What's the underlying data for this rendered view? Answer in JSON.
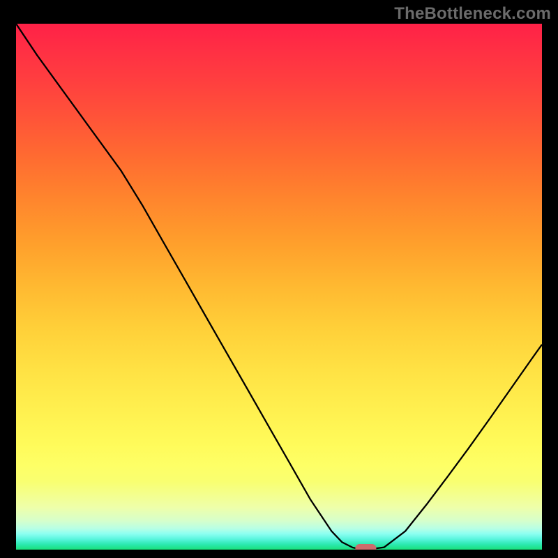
{
  "watermark": "TheBottleneck.com",
  "chart_data": {
    "type": "line",
    "title": "",
    "xlabel": "",
    "ylabel": "",
    "xlim": [
      0,
      100
    ],
    "ylim": [
      0,
      100
    ],
    "axes_visible": false,
    "grid": false,
    "series": [
      {
        "name": "bottleneck-curve",
        "x": [
          0,
          4,
          8,
          12,
          16,
          20,
          24,
          28,
          32,
          36,
          40,
          44,
          48,
          52,
          56,
          60,
          62,
          64,
          65.2,
          67.8,
          70,
          74,
          78,
          82,
          86,
          90,
          94,
          98,
          100
        ],
        "y": [
          100,
          94,
          88.5,
          83,
          77.5,
          72,
          65.5,
          58.5,
          51.5,
          44.5,
          37.5,
          30.5,
          23.5,
          16.5,
          9.5,
          3.5,
          1.4,
          0.4,
          0.15,
          0.15,
          0.45,
          3.5,
          8.5,
          13.8,
          19.2,
          24.8,
          30.5,
          36.2,
          39
        ]
      }
    ],
    "marker": {
      "x": 66.5,
      "y": 0.2,
      "label": "optimal-point",
      "color": "#cc6b6c"
    },
    "background_gradient": {
      "top": "#ff2147",
      "mid": "#ffe244",
      "bottom": "#1ae07a"
    }
  }
}
